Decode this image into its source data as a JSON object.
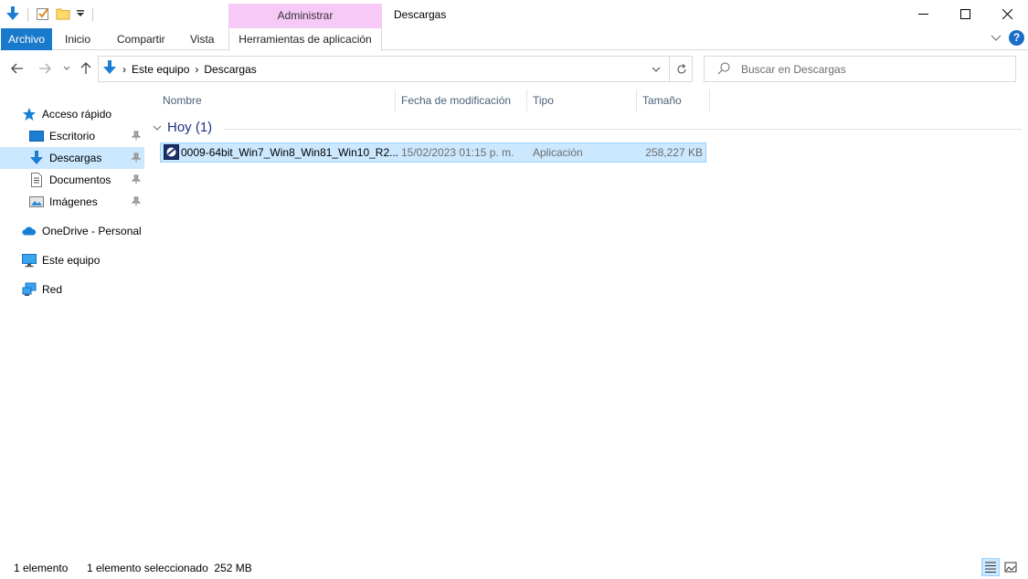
{
  "window": {
    "title": "Descargas",
    "contextual_group": "Administrar"
  },
  "ribbon": {
    "tabs": [
      {
        "label": "Archivo"
      },
      {
        "label": "Inicio"
      },
      {
        "label": "Compartir"
      },
      {
        "label": "Vista"
      },
      {
        "label": "Herramientas de aplicación"
      }
    ],
    "help_label": "?"
  },
  "address": {
    "path": [
      "Este equipo",
      "Descargas"
    ],
    "separator": "›"
  },
  "search": {
    "placeholder": "Buscar en Descargas"
  },
  "sidebar": {
    "items": [
      {
        "label": "Acceso rápido",
        "icon": "star-icon"
      },
      {
        "label": "Escritorio",
        "icon": "desktop-icon",
        "pinned": true
      },
      {
        "label": "Descargas",
        "icon": "download-arrow-icon",
        "pinned": true,
        "selected": true
      },
      {
        "label": "Documentos",
        "icon": "document-icon",
        "pinned": true
      },
      {
        "label": "Imágenes",
        "icon": "pictures-icon",
        "pinned": true
      },
      {
        "label": "OneDrive - Personal",
        "icon": "cloud-icon"
      },
      {
        "label": "Este equipo",
        "icon": "computer-icon"
      },
      {
        "label": "Red",
        "icon": "network-icon"
      }
    ]
  },
  "columns": [
    "Nombre",
    "Fecha de modificación",
    "Tipo",
    "Tamaño"
  ],
  "group": {
    "label": "Hoy (1)"
  },
  "files": [
    {
      "name": "0009-64bit_Win7_Win8_Win81_Win10_R2...",
      "date": "15/02/2023 01:15 p. m.",
      "type": "Aplicación",
      "size": "258,227 KB"
    }
  ],
  "status": {
    "count": "1 elemento",
    "selection": "1 elemento seleccionado  252 MB"
  },
  "colors": {
    "accent": "#1979ca",
    "selection": "#cce8ff",
    "contextual": "#f6c9f6",
    "group_text": "#1e3287"
  }
}
